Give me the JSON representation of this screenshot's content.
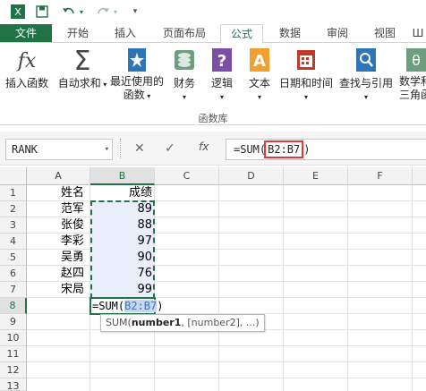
{
  "ribbon_tabs": {
    "file": "文件",
    "home": "开始",
    "insert": "插入",
    "page_layout": "页面布局",
    "formulas": "公式",
    "data": "数据",
    "review": "审阅",
    "view": "视图"
  },
  "ribbon": {
    "insert_function": "插入函数",
    "autosum": "自动求和",
    "recently_used_1": "最近使用的",
    "recently_used_2": "函数",
    "financial": "财务",
    "logical": "逻辑",
    "text": "文本",
    "date_time": "日期和时间",
    "lookup": "查找与引用",
    "math_1": "数学和",
    "math_2": "三角函",
    "group_label": "函数库"
  },
  "formula_bar": {
    "name_box": "RANK",
    "fx": "fx",
    "formula_prefix": "=SUM(",
    "formula_ref": "B2:B7",
    "formula_suffix": ")"
  },
  "grid": {
    "columns": [
      "A",
      "B",
      "C",
      "D",
      "E",
      "F"
    ],
    "rows": [
      "1",
      "2",
      "3",
      "4",
      "5",
      "6",
      "7",
      "8",
      "9",
      "10",
      "11",
      "12",
      "13"
    ],
    "header_name": "姓名",
    "header_score": "成绩",
    "names": [
      "范军",
      "张俊",
      "李彩",
      "吴勇",
      "赵四",
      "宋局"
    ],
    "scores": [
      "89",
      "88",
      "97",
      "90",
      "76",
      "99"
    ],
    "edit_prefix": "=SUM(",
    "edit_ref": "B2:B7",
    "edit_suffix": ")",
    "tooltip_fn": "SUM(",
    "tooltip_arg1": "number1",
    "tooltip_rest": ", [number2], ...)"
  },
  "colors": {
    "accent": "#217346",
    "highlight_box": "#e23a3a",
    "range_fill": "#e9eefa"
  }
}
